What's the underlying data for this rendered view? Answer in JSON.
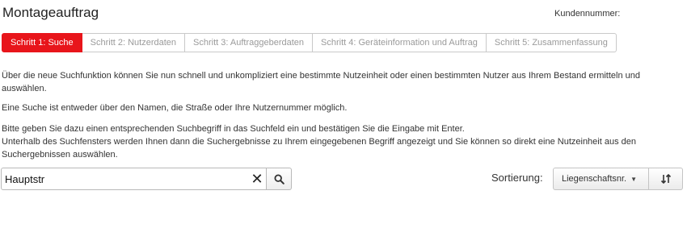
{
  "page": {
    "title": "Montageauftrag",
    "customer_number_label": "Kundennummer:"
  },
  "steps": [
    {
      "label": "Schritt 1: Suche",
      "active": true
    },
    {
      "label": "Schritt 2: Nutzerdaten",
      "active": false
    },
    {
      "label": "Schritt 3: Auftraggeberdaten",
      "active": false
    },
    {
      "label": "Schritt 4: Geräteinformation und Auftrag",
      "active": false
    },
    {
      "label": "Schritt 5: Zusammenfassung",
      "active": false
    }
  ],
  "instructions": {
    "p1": "Über die neue Suchfunktion können Sie nun schnell und unkompliziert eine bestimmte Nutzeinheit oder einen bestimmten Nutzer aus Ihrem Bestand ermitteln und auswählen.",
    "p2": "Eine Suche ist entweder über den Namen, die Straße oder Ihre Nutzernummer möglich.",
    "p3_line1": "Bitte geben Sie dazu einen entsprechenden Suchbegriff in das Suchfeld ein und bestätigen Sie die Eingabe mit Enter.",
    "p3_line2": "Unterhalb des Suchfensters werden Ihnen dann die Suchergebnisse zu Ihrem eingegebenen Begriff angezeigt und Sie können so direkt eine Nutzeinheit aus den Suchergebnissen auswählen."
  },
  "search": {
    "value": "Hauptstr",
    "clear_icon": "close-icon",
    "search_icon": "search-icon"
  },
  "sort": {
    "label": "Sortierung:",
    "selected": "Liegenschaftsnr.",
    "direction_icon": "sort-direction-icon"
  },
  "colors": {
    "accent": "#e8151b"
  }
}
